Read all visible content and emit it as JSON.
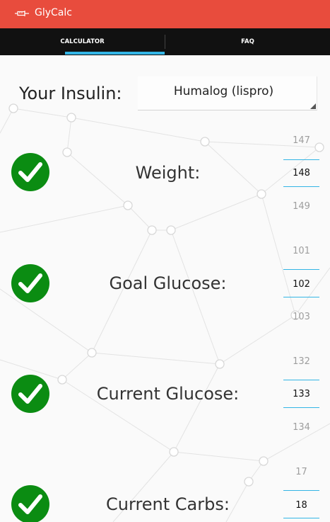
{
  "app": {
    "title": "GlyCalc",
    "icon": "syringe-icon"
  },
  "tabs": [
    {
      "label": "CALCULATOR",
      "selected": true
    },
    {
      "label": "FAQ",
      "selected": false
    }
  ],
  "colors": {
    "app_bar": "#e84c3d",
    "tab_bar": "#111111",
    "accent": "#33b5e5",
    "check": "#0b8c12"
  },
  "insulin": {
    "label": "Your Insulin:",
    "selected": "Humalog (lispro)"
  },
  "fields": [
    {
      "label": "Weight:",
      "prev": "147",
      "value": "148",
      "next": "149",
      "valid": true
    },
    {
      "label": "Goal Glucose:",
      "prev": "101",
      "value": "102",
      "next": "103",
      "valid": true
    },
    {
      "label": "Current Glucose:",
      "prev": "132",
      "value": "133",
      "next": "134",
      "valid": true
    },
    {
      "label": "Current Carbs:",
      "prev": "17",
      "value": "18",
      "next": "",
      "valid": true
    }
  ]
}
